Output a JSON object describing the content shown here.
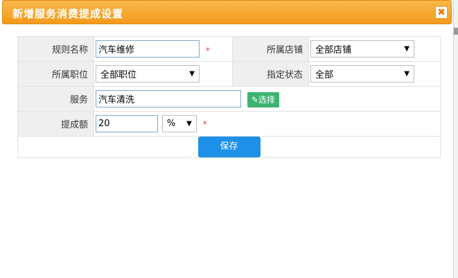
{
  "dialog": {
    "title": "新增服务消费提成设置",
    "close_glyph": "✖"
  },
  "form": {
    "rule_name": {
      "label": "规则名称",
      "value": "汽车维修",
      "required_mark": "*"
    },
    "store": {
      "label": "所属店铺",
      "selected": "全部店铺"
    },
    "position": {
      "label": "所属职位",
      "selected": "全部职位"
    },
    "status": {
      "label": "指定状态",
      "selected": "全部"
    },
    "service": {
      "label": "服务",
      "value": "汽车清洗",
      "pick_label": "✎选择"
    },
    "commission": {
      "label": "提成额",
      "value": "20",
      "unit": "%",
      "required_mark": "*"
    }
  },
  "actions": {
    "save_label": "保存"
  },
  "colors": {
    "title_bar": "#f39a1c",
    "save_button": "#1e90e8",
    "pick_button": "#3cb371",
    "required": "#e53935"
  }
}
